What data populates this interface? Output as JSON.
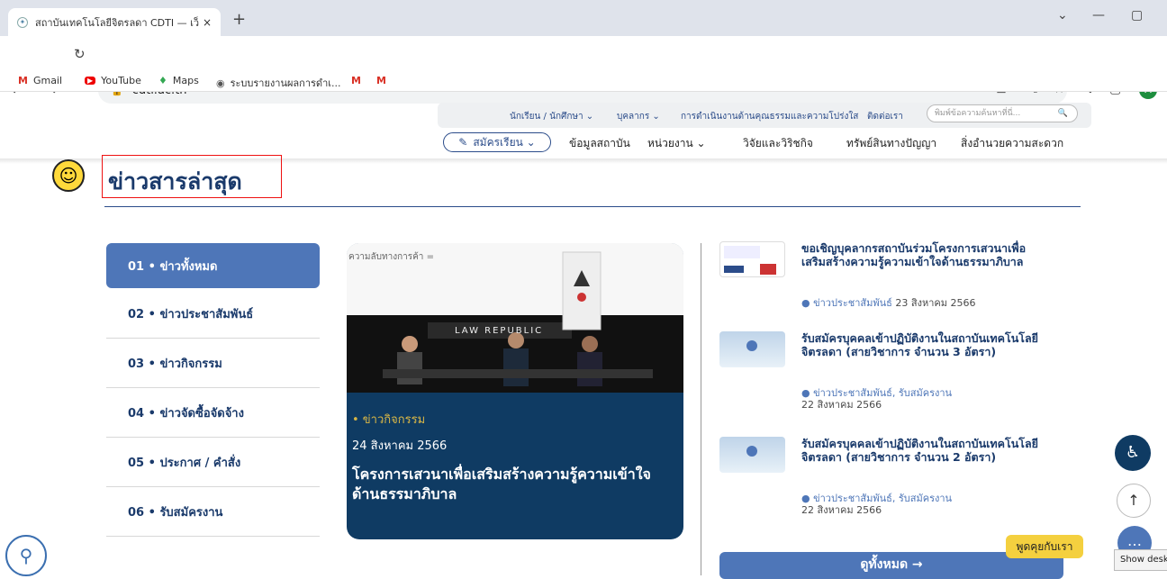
{
  "browser": {
    "tab_title": "สถาบันเทคโนโลยีจิตรลดา CDTI — เว็บ",
    "tab_close": "×",
    "new_tab": "+",
    "url": "cdti.ac.th",
    "win_min": "—",
    "win_max": "▢",
    "win_expand": "⌄",
    "avatar": "A"
  },
  "bookmarks": [
    "Gmail",
    "YouTube",
    "Maps",
    "ระบบรายงานผลการดำเ..."
  ],
  "topnav": {
    "students": "นักเรียน / นักศึกษา ⌄",
    "staff": "บุคลากร ⌄",
    "ethics": "การดำเนินงานด้านคุณธรรมและความโปร่งใส",
    "contact": "ติดต่อเรา",
    "search_placeholder": "พิมพ์ข้อความค้นหาที่นี่..."
  },
  "mainnav": {
    "register": "สมัครเรียน ⌄",
    "info": "ข้อมูลสถาบัน",
    "units": "หน่วยงาน ⌄",
    "research": "วิจัยและวิริชกิจ",
    "ip": "ทรัพย์สินทางปัญญา",
    "facilities": "สิ่งอำนวยความสะดวก"
  },
  "section_title": "ข่าวสารล่าสุด",
  "categories": [
    "01 • ข่าวทั้งหมด",
    "02 • ข่าวประชาสัมพันธ์",
    "03 • ข่าวกิจกรรม",
    "04 • ข่าวจัดซื้อจัดจ้าง",
    "05 • ประกาศ / คำสั่ง",
    "06 • รับสมัครงาน"
  ],
  "featured": {
    "caption": "ความลับทางการค้า =",
    "photo_banner": "LAW REPUBLIC",
    "category": "• ข่าวกิจกรรม",
    "date": "24 สิงหาคม 2566",
    "title": "โครงการเสวนาเพื่อเสริมสร้างความรู้ความเข้าใจด้านธรรมาภิบาล"
  },
  "news": [
    {
      "title": "ขอเชิญบุคลากรสถาบันร่วมโครงการเสวนาเพื่อเสริมสร้างความรู้ความเข้าใจด้านธรรมาภิบาล",
      "category": "● ข่าวประชาสัมพันธ์",
      "date": "23 สิงหาคม 2566"
    },
    {
      "title": "รับสมัครบุคคลเข้าปฏิบัติงานในสถาบันเทคโนโลยีจิตรลดา (สายวิชาการ จำนวน 3 อัตรา)",
      "category": "● ข่าวประชาสัมพันธ์, รับสมัครงาน",
      "date": "22 สิงหาคม 2566"
    },
    {
      "title": "รับสมัครบุคคลเข้าปฏิบัติงานในสถาบันเทคโนโลยีจิตรลดา (สายวิชาการ จำนวน 2 อัตรา)",
      "category": "● ข่าวประชาสัมพันธ์, รับสมัครงาน",
      "date": "22 สิงหาคม 2566"
    }
  ],
  "view_all": "ดูทั้งหมด →",
  "chat_label": "พูดคุยกับเรา",
  "show_desktop": "Show desktop"
}
